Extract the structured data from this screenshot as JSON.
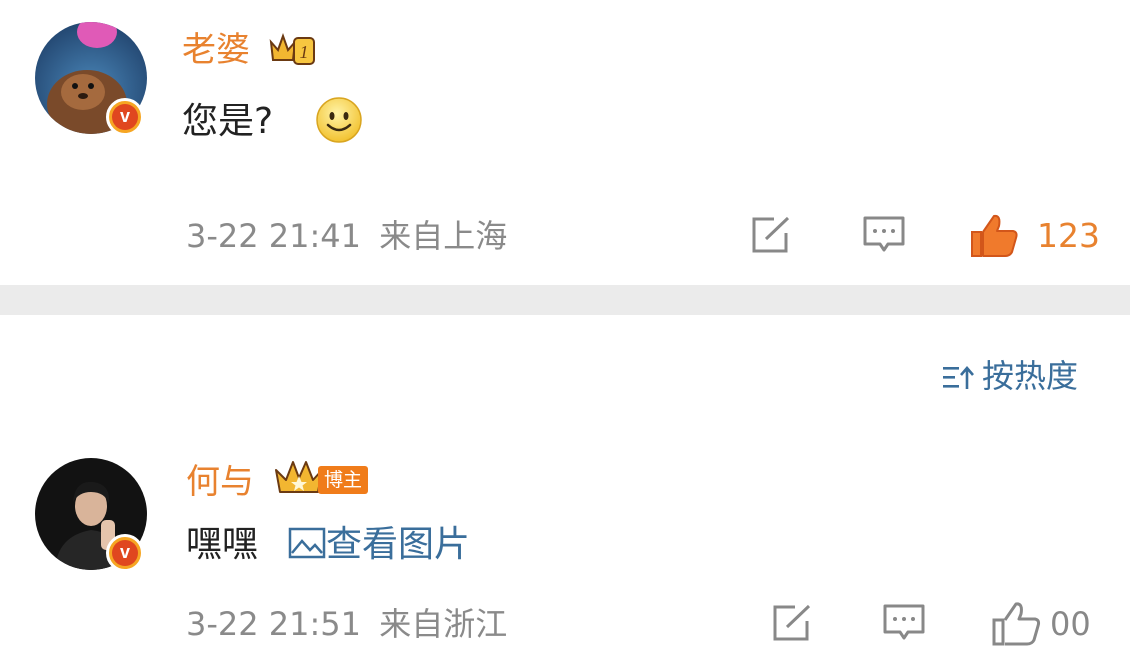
{
  "comments": [
    {
      "username": "老婆",
      "badge_icon": "level-crown-icon",
      "badge_level": "1",
      "content": "您是?",
      "emoji": "smile-emoji-icon",
      "time": "3-22 21:41",
      "location": "来自上海",
      "likes": "123"
    },
    {
      "username": "何与",
      "badge_icon": "crown-icon",
      "badge_label": "博主",
      "content": "嘿嘿",
      "image_link": "查看图片",
      "time": "3-22 21:51",
      "location": "来自浙江",
      "likes": "00"
    }
  ],
  "sort": {
    "icon": "sort-icon",
    "label": "按热度"
  },
  "colors": {
    "username": "#e8822f",
    "link": "#3a6e9b",
    "meta": "#8a8a8a",
    "divider": "#ebebeb",
    "like_active": "#f07a2c"
  }
}
